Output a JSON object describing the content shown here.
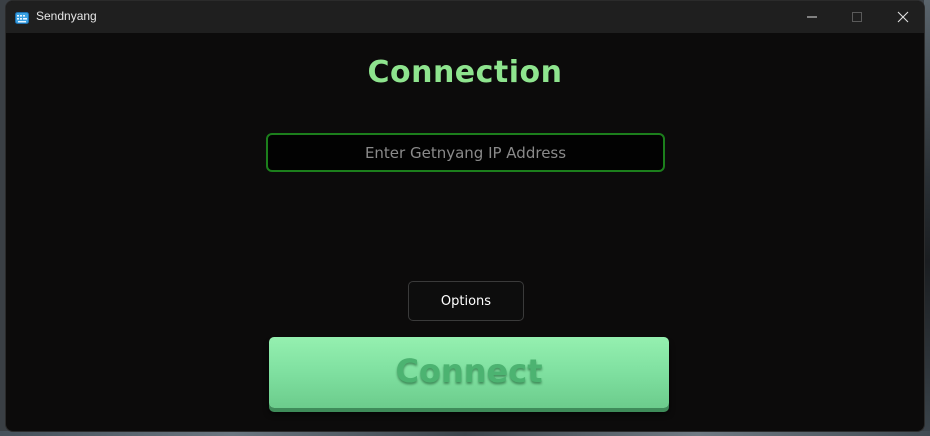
{
  "window": {
    "title": "Sendnyang"
  },
  "main": {
    "heading": "Connection",
    "ip_input": {
      "placeholder": "Enter Getnyang IP Address",
      "value": ""
    },
    "options_label": "Options",
    "connect_label": "Connect"
  },
  "colors": {
    "heading": "#8ee48e",
    "input_border": "#1c7f1c",
    "connect_button": "#7fe0a0",
    "connect_text": "#4cb371",
    "window_bg": "#0c0b0b",
    "titlebar_bg": "#1f1f1f"
  },
  "icons": {
    "app": "keyboard-icon",
    "minimize": "minimize-icon",
    "maximize": "maximize-icon",
    "close": "close-icon"
  }
}
